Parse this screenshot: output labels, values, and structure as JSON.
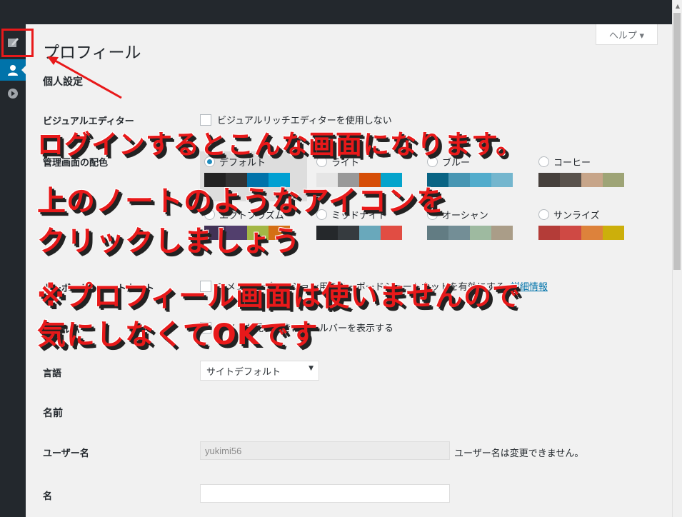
{
  "page": {
    "title": "プロフィール",
    "help_label": "ヘルプ ▾"
  },
  "sections": {
    "personal": "個人設定",
    "name": "名前"
  },
  "visual_editor": {
    "label": "ビジュアルエディター",
    "checkbox_text": "ビジュアルリッチエディターを使用しない"
  },
  "admin_color": {
    "label": "管理画面の配色",
    "schemes": [
      {
        "name": "デフォルト",
        "selected": true,
        "colors": [
          "#222222",
          "#333333",
          "#0073aa",
          "#00a0d2"
        ]
      },
      {
        "name": "ライト",
        "selected": false,
        "colors": [
          "#e5e5e5",
          "#999999",
          "#d64e07",
          "#04a4cc"
        ]
      },
      {
        "name": "ブルー",
        "selected": false,
        "colors": [
          "#096484",
          "#4796b3",
          "#52accc",
          "#74b6ce"
        ]
      },
      {
        "name": "コーヒー",
        "selected": false,
        "colors": [
          "#46403c",
          "#59524c",
          "#c7a589",
          "#9ea476"
        ]
      },
      {
        "name": "エクトプラズム",
        "selected": false,
        "colors": [
          "#413256",
          "#523f6d",
          "#a3b745",
          "#d46f15"
        ]
      },
      {
        "name": "ミッドナイト",
        "selected": false,
        "colors": [
          "#25282b",
          "#363b3f",
          "#69a8bb",
          "#e14d43"
        ]
      },
      {
        "name": "オーシャン",
        "selected": false,
        "colors": [
          "#627c83",
          "#738e96",
          "#9ebaa0",
          "#aa9d88"
        ]
      },
      {
        "name": "サンライズ",
        "selected": false,
        "colors": [
          "#b43c38",
          "#cf4944",
          "#dd823b",
          "#ccaf0b"
        ]
      }
    ]
  },
  "keyboard": {
    "label": "キーボードショートカット",
    "checkbox_text": "コメントモデレーション用のキーボードショートカットを有効にする",
    "link": "詳細情報"
  },
  "toolbar": {
    "label": "ツールバー",
    "checkbox_text": "サイトを見るときにツールバーを表示する"
  },
  "language": {
    "label": "言語",
    "value": "サイトデフォルト"
  },
  "username": {
    "label": "ユーザー名",
    "value": "yukimi56",
    "hint": "ユーザー名は変更できません。"
  },
  "firstname": {
    "label": "名",
    "value": ""
  },
  "annotations": {
    "line1": "ログインするとこんな画面になります。",
    "line2": "上のノートのようなアイコンを",
    "line3": "クリックしましょう",
    "line4": "※プロフィール画面は使いませんので",
    "line5": "気にしなくてOKです"
  },
  "icons": [
    "edit-note-icon",
    "user-icon",
    "play-circle-icon"
  ]
}
